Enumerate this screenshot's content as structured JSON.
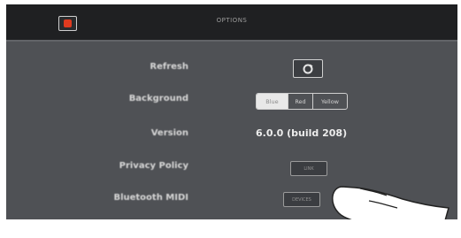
{
  "titlebar": {
    "title": "OPTIONS"
  },
  "rows": {
    "refresh_label": "Refresh",
    "background_label": "Background",
    "version_label": "Version",
    "privacy_label": "Privacy Policy",
    "bluetooth_label": "Bluetooth MIDI"
  },
  "background_options": [
    "Blue",
    "Red",
    "Yellow"
  ],
  "background_selected": "Blue",
  "version_value": "6.0.0 (build 208)",
  "buttons": {
    "link_label": "LINK",
    "devices_label": "DEVICES"
  },
  "colors": {
    "close_accent": "#e03a1f",
    "panel_bg": "#4f5155",
    "titlebar_bg": "#1f2022"
  },
  "icons": {
    "close": "close-icon",
    "refresh": "refresh-icon",
    "pointer": "hand-pointer-icon"
  }
}
